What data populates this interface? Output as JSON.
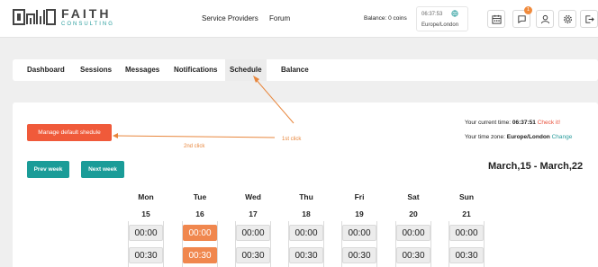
{
  "brand": {
    "name": "FAITH",
    "subtitle": "CONSULTING"
  },
  "nav": {
    "providers": "Service Providers",
    "forum": "Forum"
  },
  "balance": "Balance: 0 coins",
  "clock": {
    "time": "06:37:53",
    "timezone": "Europe/London"
  },
  "header_icons": [
    "calendar-icon",
    "chat-icon",
    "user-icon",
    "gear-icon",
    "logout-icon"
  ],
  "notification_count": "1",
  "tabs": [
    {
      "label": "Dashboard"
    },
    {
      "label": "Sessions"
    },
    {
      "label": "Messages"
    },
    {
      "label": "Notifications"
    },
    {
      "label": "Schedule"
    },
    {
      "label": "Balance"
    }
  ],
  "active_tab": "Schedule",
  "manage_button": "Manage default shedule",
  "annotations": {
    "second": "2nd click",
    "first": "1st click"
  },
  "time_info": {
    "current_label": "Your current time:",
    "current_value": "06:37:51",
    "check_link": "Check it!",
    "zone_label": "Your time zone:",
    "zone_value": "Europe/London",
    "change_link": "Change"
  },
  "prev_week": "Prev week",
  "next_week": "Next week",
  "date_range": "March,15 - March,22",
  "days": [
    {
      "name": "Mon",
      "date": "15",
      "slots": [
        "00:00",
        "00:30"
      ],
      "selected": [
        false,
        false
      ]
    },
    {
      "name": "Tue",
      "date": "16",
      "slots": [
        "00:00",
        "00:30"
      ],
      "selected": [
        true,
        true
      ]
    },
    {
      "name": "Wed",
      "date": "17",
      "slots": [
        "00:00",
        "00:30"
      ],
      "selected": [
        false,
        false
      ]
    },
    {
      "name": "Thu",
      "date": "18",
      "slots": [
        "00:00",
        "00:30"
      ],
      "selected": [
        false,
        false
      ]
    },
    {
      "name": "Fri",
      "date": "19",
      "slots": [
        "00:00",
        "00:30"
      ],
      "selected": [
        false,
        false
      ]
    },
    {
      "name": "Sat",
      "date": "20",
      "slots": [
        "00:00",
        "00:30"
      ],
      "selected": [
        false,
        false
      ]
    },
    {
      "name": "Sun",
      "date": "21",
      "slots": [
        "00:00",
        "00:30"
      ],
      "selected": [
        false,
        false
      ]
    }
  ],
  "colors": {
    "accent_red": "#f05a3a",
    "teal": "#1a9c98",
    "selected_slot": "#f0874e",
    "annotation": "#e8863c"
  }
}
